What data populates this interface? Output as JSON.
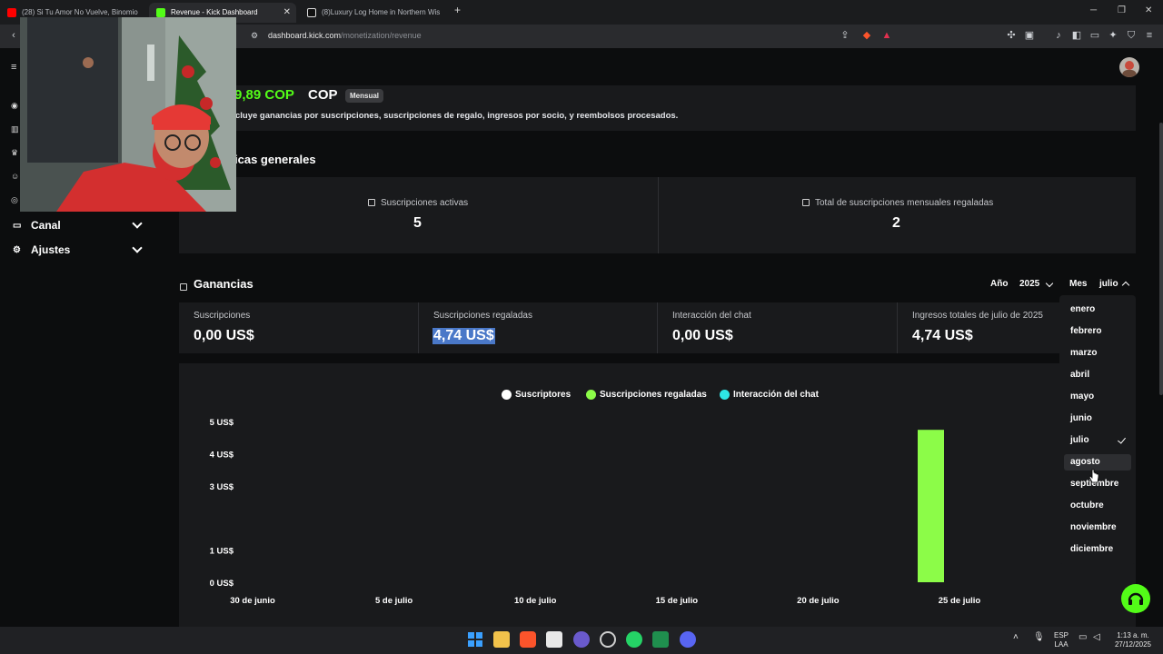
{
  "browser": {
    "tabs": [
      {
        "title": "(28) Si Tu Amor No Vuelve, Binomio",
        "favicon_color": "#ff0000"
      },
      {
        "title": "Revenue - Kick Dashboard",
        "favicon_color": "#53fc18"
      },
      {
        "title": "(8)Luxury Log Home in Northern Wis",
        "favicon_color": "#ffffff"
      }
    ],
    "url_host": "dashboard.kick.com",
    "url_path": "/monetization/revenue"
  },
  "sidebar": {
    "items": [
      {
        "label": "Canal",
        "icon": "tv-icon"
      },
      {
        "label": "Ajustes",
        "icon": "gear-icon"
      }
    ]
  },
  "earnings": {
    "amount": "9,89 COP",
    "currency": "COP",
    "period_badge": "Mensual",
    "description": "cluye ganancias por suscripciones, suscripciones de regalo, ingresos por socio, y reembolsos procesados."
  },
  "stats": {
    "title": "icas generales",
    "cards": [
      {
        "label": "Suscripciones activas",
        "value": "5"
      },
      {
        "label": "Total de suscripciones mensuales regaladas",
        "value": "2"
      }
    ]
  },
  "ganancias": {
    "title": "Ganancias",
    "year_label": "Año",
    "year_value": "2025",
    "month_label": "Mes",
    "month_value": "julio",
    "cards": [
      {
        "label": "Suscripciones",
        "value": "0,00 US$"
      },
      {
        "label": "Suscripciones regaladas",
        "value": "4,74 US$"
      },
      {
        "label": "Interacción del chat",
        "value": "0,00 US$"
      },
      {
        "label": "Ingresos totales de julio de 2025",
        "value": "4,74 US$"
      }
    ]
  },
  "month_menu": {
    "items": [
      "enero",
      "febrero",
      "marzo",
      "abril",
      "mayo",
      "junio",
      "julio",
      "agosto",
      "septiembre",
      "octubre",
      "noviembre",
      "diciembre"
    ],
    "selected": "julio",
    "hovered": "agosto"
  },
  "chart_data": {
    "type": "bar",
    "legend": [
      {
        "name": "Suscriptores",
        "color": "#ffffff"
      },
      {
        "name": "Suscripciones regaladas",
        "color": "#8cfc48"
      },
      {
        "name": "Interacción del chat",
        "color": "#2ee6e6"
      }
    ],
    "y_ticks": [
      "5 US$",
      "4 US$",
      "3 US$",
      "1 US$",
      "0 US$"
    ],
    "x_ticks": [
      "30 de junio",
      "5 de julio",
      "10 de julio",
      "15 de julio",
      "20 de julio",
      "25 de julio"
    ],
    "series": [
      {
        "name": "Suscripciones regaladas",
        "points": [
          {
            "x": "25 de julio",
            "y": 4.74
          }
        ]
      }
    ],
    "ylim": [
      0,
      5
    ]
  },
  "taskbar": {
    "lang_top": "ESP",
    "lang_bottom": "LAA",
    "time": "1:13 a. m.",
    "date": "27/12/2025"
  },
  "colors": {
    "accent": "#53fc18",
    "panel": "#191a1c",
    "background": "#0c0d0e"
  }
}
